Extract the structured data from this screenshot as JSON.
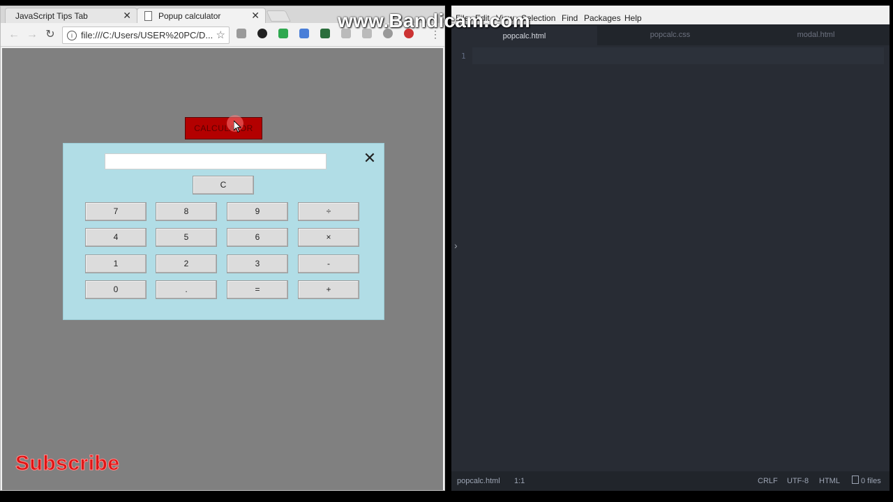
{
  "browser": {
    "tabs": [
      {
        "title": "JavaScript Tips Tab"
      },
      {
        "title": "Popup calculator"
      }
    ],
    "url": "file:///C:/Users/USER%20PC/D..."
  },
  "page": {
    "open_button_label": "CALCULATOR",
    "display_value": "",
    "close_glyph": "✕",
    "clear_label": "C",
    "keys": [
      "7",
      "8",
      "9",
      "÷",
      "4",
      "5",
      "6",
      "×",
      "1",
      "2",
      "3",
      "-",
      "0",
      ".",
      "=",
      "+"
    ],
    "subscribe_text": "Subscribe"
  },
  "editor": {
    "menu": [
      "File",
      "Edit",
      "View",
      "Selection",
      "Find",
      "Packages",
      "Help"
    ],
    "tabs": [
      "popcalc.html",
      "popcalc.css",
      "modal.html"
    ],
    "line_number": "1",
    "status": {
      "file": "popcalc.html",
      "cursor": "1:1",
      "line_ending": "CRLF",
      "encoding": "UTF-8",
      "grammar": "HTML",
      "files": "0 files"
    }
  },
  "watermark": "www.Bandicam.com",
  "colors": {
    "modal_bg": "#b1dde6",
    "open_button": "#b30000",
    "editor_bg": "#282c34"
  }
}
